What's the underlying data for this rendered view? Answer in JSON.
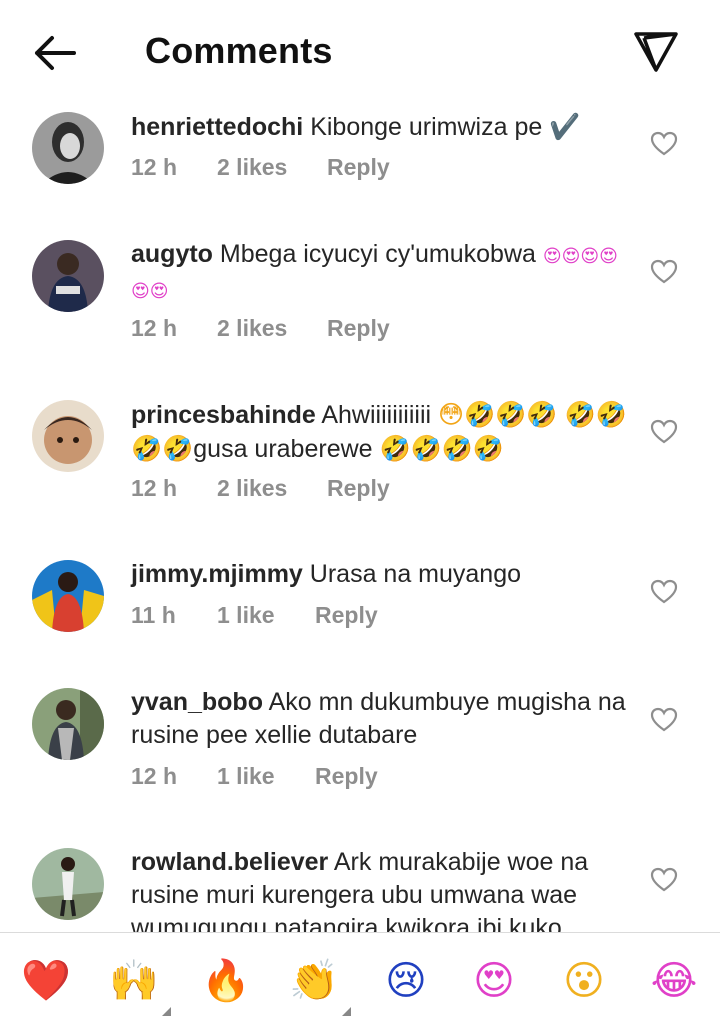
{
  "header": {
    "title": "Comments",
    "back_icon": "arrow-left-icon",
    "share_icon": "paper-plane-icon"
  },
  "comments": [
    {
      "username": "henriettedochi",
      "text": "Kibonge urimwiza pe",
      "emoji": "✔️",
      "time": "12 h",
      "likes": "2 likes",
      "reply": "Reply"
    },
    {
      "username": "augyto",
      "text": "Mbega icyucyi cy'umukobwa",
      "emoji": "😍😍😍😍😍😍",
      "time": "12 h",
      "likes": "2 likes",
      "reply": "Reply"
    },
    {
      "username": "princesbahinde",
      "text": "Ahwiiiiiiiiiii",
      "emoji_a": "😳🤣🤣🤣",
      "emoji_b": "🤣🤣🤣🤣",
      "text_b": "gusa uraberewe",
      "emoji_c": "🤣🤣🤣🤣",
      "time": "12 h",
      "likes": "2 likes",
      "reply": "Reply"
    },
    {
      "username": "jimmy.mjimmy",
      "text": "Urasa na muyango",
      "time": "11 h",
      "likes": "1 like",
      "reply": "Reply"
    },
    {
      "username": "yvan_bobo",
      "text": "Ako mn dukumbuye mugisha na rusine pee xellie dutabare",
      "time": "12 h",
      "likes": "1 like",
      "reply": "Reply"
    },
    {
      "username": "rowland.believer",
      "text": "Ark murakabije woe na rusine muri kurengera ubu umwana wae wumugungu natangira kwikora ibi kuko"
    }
  ],
  "reactions": [
    {
      "emoji": "❤️",
      "icon": "red-heart-icon"
    },
    {
      "emoji": "🙌",
      "icon": "raising-hands-icon"
    },
    {
      "emoji": "🔥",
      "icon": "fire-icon"
    },
    {
      "emoji": "👏",
      "icon": "clapping-hands-icon"
    },
    {
      "emoji": "😢",
      "icon": "crying-face-icon"
    },
    {
      "emoji": "😍",
      "icon": "heart-eyes-icon"
    },
    {
      "emoji": "😮",
      "icon": "surprised-face-icon"
    },
    {
      "emoji": "😂",
      "icon": "laughing-face-icon"
    }
  ],
  "colors": {
    "text": "#262626",
    "meta": "#8e8e8e",
    "divider": "#dbdbdb"
  }
}
